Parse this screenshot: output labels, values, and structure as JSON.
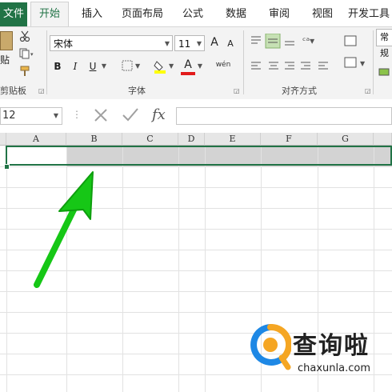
{
  "menu": {
    "file": "文件",
    "tabs": [
      "开始",
      "插入",
      "页面布局",
      "公式",
      "数据",
      "审阅",
      "视图",
      "开发工具"
    ],
    "active_tab": "开始"
  },
  "clipboard": {
    "paste": "贴",
    "label": "剪贴板"
  },
  "font": {
    "name": "宋体",
    "size": "11",
    "bold": "B",
    "italic": "I",
    "underline": "U",
    "grow": "A",
    "shrink": "A",
    "color": "A",
    "phonetic": "wén",
    "label": "字体"
  },
  "alignment": {
    "label": "对齐方式"
  },
  "number": {
    "format": "常规"
  },
  "formula_bar": {
    "name_box": "12",
    "fx": "fx",
    "value": ""
  },
  "columns": [
    "A",
    "B",
    "C",
    "D",
    "E",
    "F",
    "G"
  ],
  "watermark": {
    "text": "查询啦",
    "url": "chaxunla.com"
  },
  "colors": {
    "accent": "#217346",
    "arrow": "#22dd22",
    "watermark_orange": "#f5a623",
    "watermark_blue": "#1e88e5"
  }
}
